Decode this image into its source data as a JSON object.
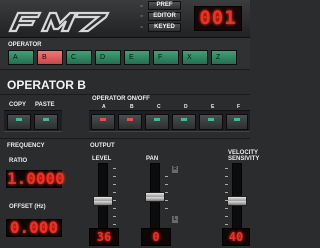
{
  "header": {
    "logo_text": "FM7",
    "buttons": [
      "PREF",
      "EDITOR",
      "KEYED"
    ],
    "program_display": "001"
  },
  "operator_select": {
    "label": "OPERATOR",
    "items": [
      "A",
      "B",
      "C",
      "D",
      "E",
      "F",
      "X",
      "Z"
    ],
    "selected": "B"
  },
  "panel": {
    "title": "OPERATOR B",
    "copy_label": "COPY",
    "paste_label": "PASTE",
    "onoff_label": "OPERATOR ON/OFF",
    "onoff_items": [
      "A",
      "B",
      "C",
      "D",
      "E",
      "F"
    ],
    "frequency_label": "FREQUENCY",
    "ratio_label": "RATIO",
    "ratio_value": "1.0000",
    "offset_label": "OFFSET (Hz)",
    "offset_value": "0.000",
    "output_label": "OUTPUT",
    "level_label": "LEVEL",
    "level_value": "36",
    "pan_label": "PAN",
    "pan_value": "0",
    "pan_right_mark": "R",
    "pan_left_mark": "L",
    "velocity_label": "VELOCITY SENSIVITY",
    "velocity_value": "40"
  },
  "colors": {
    "accent_green": "#3fa178",
    "selected_red": "#e06060",
    "lcd_red": "#ff2a1a"
  }
}
